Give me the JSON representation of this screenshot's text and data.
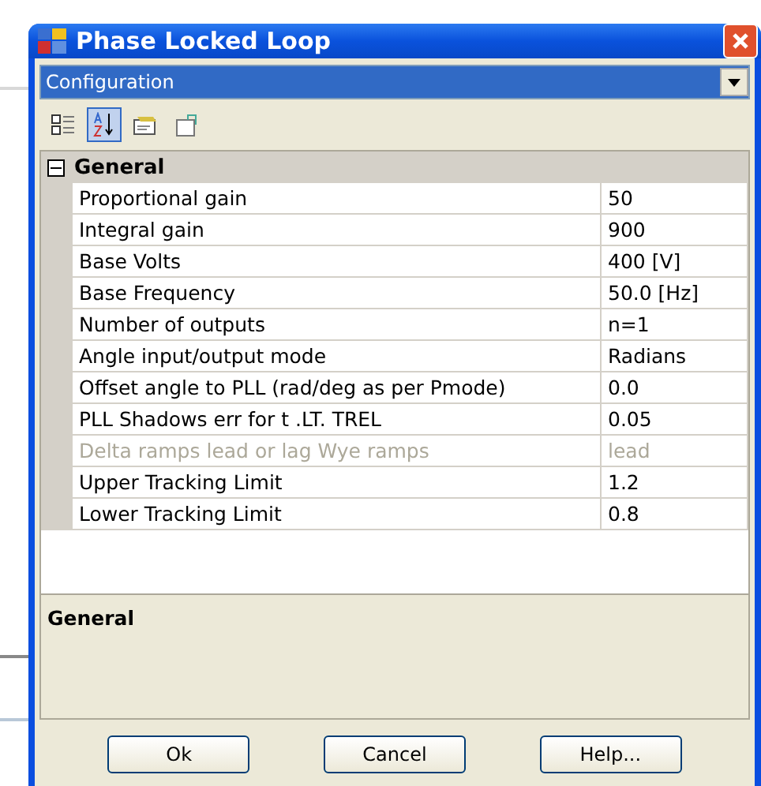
{
  "window": {
    "title": "Phase Locked Loop"
  },
  "object_selector": {
    "value": "Configuration"
  },
  "toolbar": [
    {
      "kind": "categorized",
      "selected": false
    },
    {
      "kind": "alphabetical",
      "selected": true
    },
    {
      "kind": "properties",
      "selected": false
    },
    {
      "kind": "pages",
      "selected": false
    }
  ],
  "category": {
    "label": "General",
    "expanded": true
  },
  "properties": [
    {
      "name": "Proportional gain",
      "value": "50",
      "disabled": false
    },
    {
      "name": "Integral gain",
      "value": "900",
      "disabled": false
    },
    {
      "name": "Base Volts",
      "value": "400 [V]",
      "disabled": false
    },
    {
      "name": "Base Frequency",
      "value": "50.0 [Hz]",
      "disabled": false
    },
    {
      "name": "Number of outputs",
      "value": "n=1",
      "disabled": false
    },
    {
      "name": "Angle input/output mode",
      "value": "Radians",
      "disabled": false
    },
    {
      "name": "Offset angle to PLL (rad/deg as per  Pmode)",
      "value": "0.0",
      "disabled": false
    },
    {
      "name": "PLL Shadows err for t .LT. TREL",
      "value": "0.05",
      "disabled": false
    },
    {
      "name": "Delta ramps lead or lag Wye ramps",
      "value": "lead",
      "disabled": true
    },
    {
      "name": "Upper Tracking Limit",
      "value": "1.2",
      "disabled": false
    },
    {
      "name": "Lower Tracking Limit",
      "value": "0.8",
      "disabled": false
    }
  ],
  "description": {
    "title": "General"
  },
  "buttons": [
    "Ok",
    "Cancel",
    "Help..."
  ]
}
